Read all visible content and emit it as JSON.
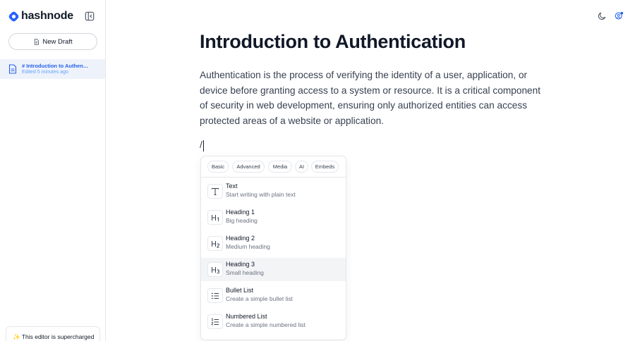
{
  "brand": {
    "name": "hashnode",
    "accent": "#2962ff"
  },
  "sidebar": {
    "new_draft_label": "New Draft",
    "drafts": [
      {
        "title": "# Introduction to Authentication",
        "meta": "Edited 5 minutes ago"
      }
    ],
    "banner_text": "✨ This editor is supercharged"
  },
  "toolbar": {
    "icons": [
      "moon-icon",
      "account-settings-icon"
    ]
  },
  "document": {
    "title": "Introduction to Authentication",
    "body": "Authentication is the process of verifying the identity of a user, application, or device before granting access to a system or resource. It is a critical component of security in web development, ensuring only authorized entities can access protected areas of a website or application.",
    "slash_text": "/"
  },
  "slash_menu": {
    "tabs": [
      "Basic",
      "Advanced",
      "Media",
      "AI",
      "Embeds"
    ],
    "items": [
      {
        "title": "Text",
        "description": "Start writing with plain text",
        "icon": "text-icon"
      },
      {
        "title": "Heading 1",
        "description": "Big heading",
        "icon": "heading-1-icon"
      },
      {
        "title": "Heading 2",
        "description": "Medium heading",
        "icon": "heading-2-icon"
      },
      {
        "title": "Heading 3",
        "description": "Small heading",
        "icon": "heading-3-icon",
        "highlighted": true
      },
      {
        "title": "Bullet List",
        "description": "Create a simple bullet list",
        "icon": "bullet-list-icon"
      },
      {
        "title": "Numbered List",
        "description": "Create a simple numbered list",
        "icon": "numbered-list-icon"
      }
    ]
  }
}
